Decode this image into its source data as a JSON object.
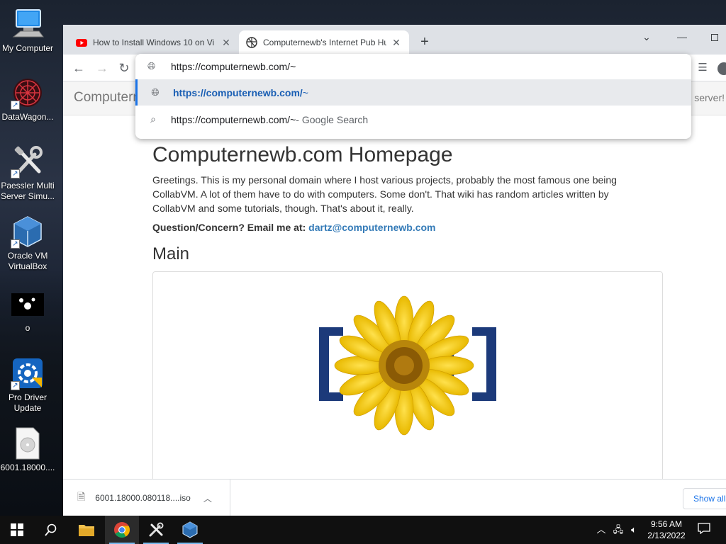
{
  "desktop": {
    "icons": [
      {
        "label": "My Computer",
        "icon": "computer-icon"
      },
      {
        "label": "DataWagon...",
        "icon": "datawagon-icon"
      },
      {
        "label": "Paessler Multi Server Simu...",
        "icon": "tools-icon"
      },
      {
        "label": "Oracle VM VirtualBox",
        "icon": "virtualbox-icon"
      },
      {
        "label": "o",
        "icon": "o-file-icon"
      },
      {
        "label": "Pro Driver Update",
        "icon": "driver-update-icon"
      },
      {
        "label": "6001.18000....",
        "icon": "iso-disc-icon"
      }
    ]
  },
  "browser": {
    "tabs": [
      {
        "title": "How to Install Windows 10 on Vi",
        "icon": "youtube-icon",
        "active": false
      },
      {
        "title": "Computernewb's Internet Pub Hu",
        "icon": "computernewb-favicon",
        "active": true
      }
    ],
    "address_value": "https://computernewb.com/~",
    "omnibox": {
      "suggestions": [
        {
          "bold": "https://computernewb.com/",
          "rest": "~",
          "icon": "globe-icon"
        },
        {
          "text": "https://computernewb.com/~",
          "suffix": " - Google Search",
          "icon": "search-icon"
        }
      ]
    },
    "download": {
      "filename": "6001.18000.080118....iso",
      "show_all": "Show all"
    }
  },
  "page": {
    "brand": "Computern",
    "header_right": "server!",
    "title": "Computernewb.com Homepage",
    "intro": "Greetings. This is my personal domain where I host various projects, probably the most famous one being CollabVM. A lot of them have to do with computers. Some don't. That wiki has random articles written by CollabVM and some tutorials, though. That's about it, really.",
    "contact_label": "Question/Concern? Email me at: ",
    "contact_email": "dartz@computernewb.com",
    "main_heading": "Main"
  },
  "taskbar": {
    "apps": [
      "file-explorer-icon",
      "chrome-icon",
      "tools-icon",
      "virtualbox-icon"
    ],
    "time": "9:56 AM",
    "date": "2/13/2022"
  },
  "colors": {
    "accent": "#1a73e8",
    "link": "#337ab7",
    "taskbar": "#101010"
  }
}
